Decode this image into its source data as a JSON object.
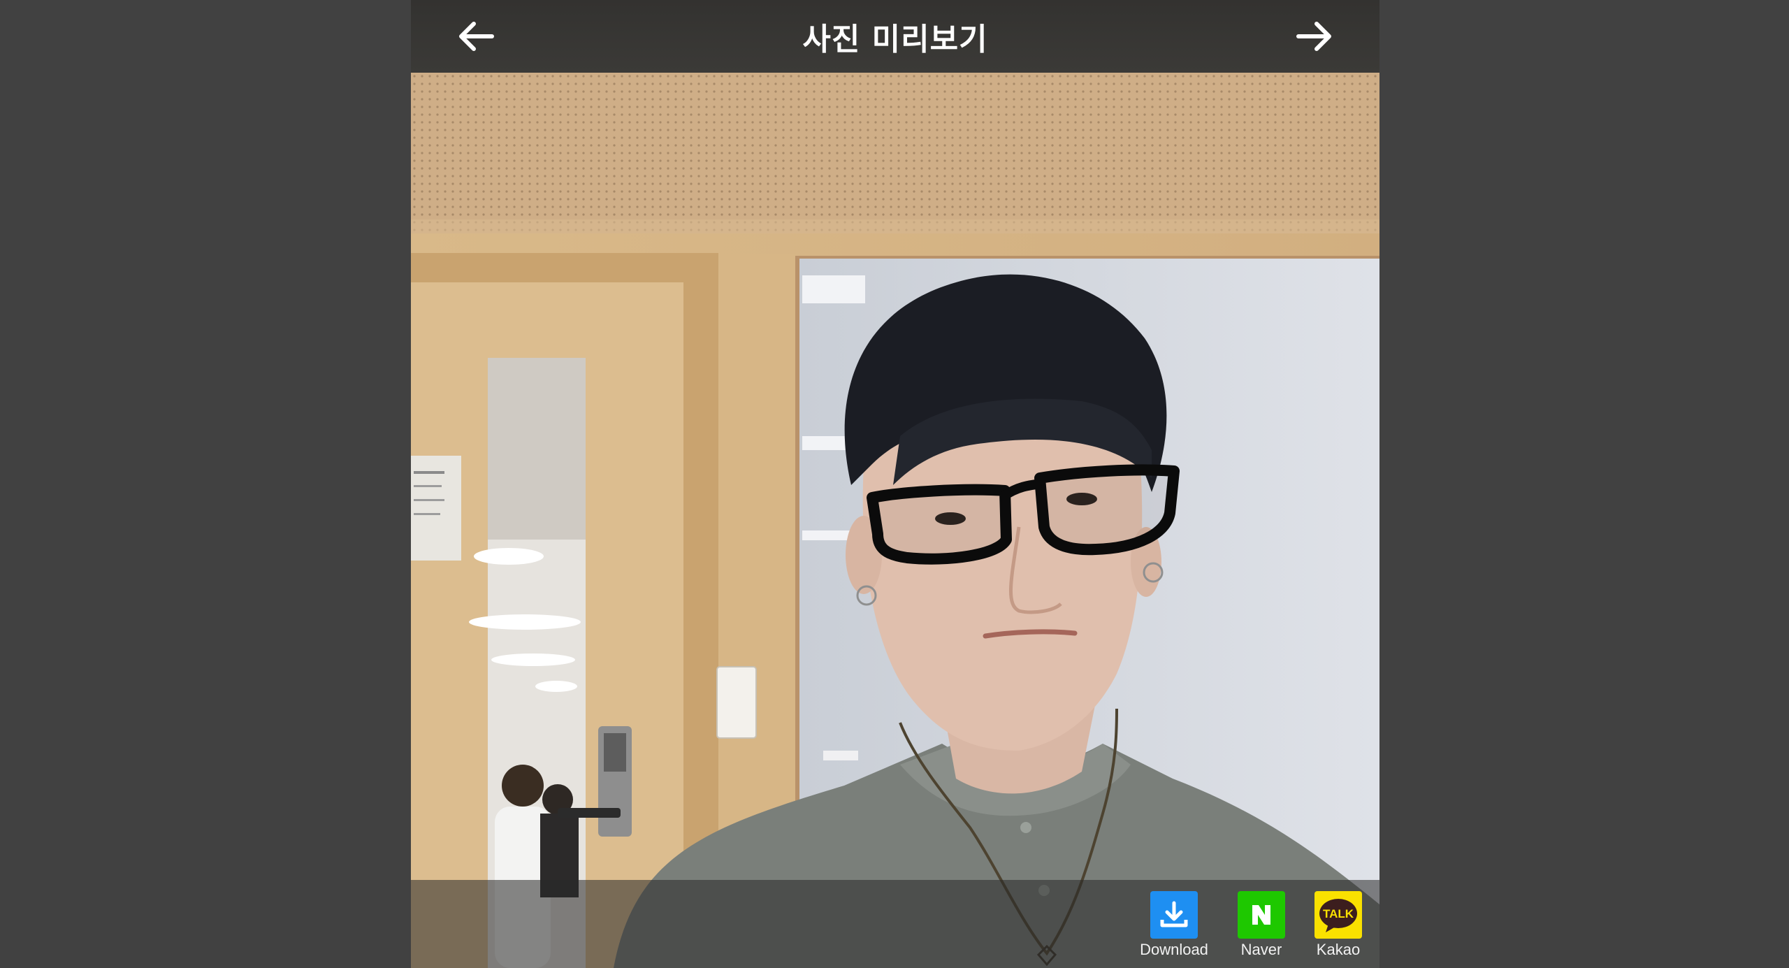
{
  "header": {
    "title": "사진 미리보기",
    "back_icon": "arrow-left-icon",
    "next_icon": "arrow-right-icon"
  },
  "photo": {
    "subject": "camera preview photo",
    "overlays": [
      "glasses-filter",
      "necklace-filter",
      "earring-filter"
    ]
  },
  "share": {
    "items": [
      {
        "label": "Download",
        "icon": "download-icon",
        "color": "#1e8ff2"
      },
      {
        "label": "Naver",
        "icon": "naver-icon",
        "color": "#1ec800"
      },
      {
        "label": "Kakao",
        "icon": "kakaotalk-icon",
        "color": "#fae100",
        "icon_text": "TALK"
      }
    ]
  },
  "colors": {
    "page_background": "#414141",
    "header_background": "#383734",
    "header_text": "#ffffff"
  }
}
